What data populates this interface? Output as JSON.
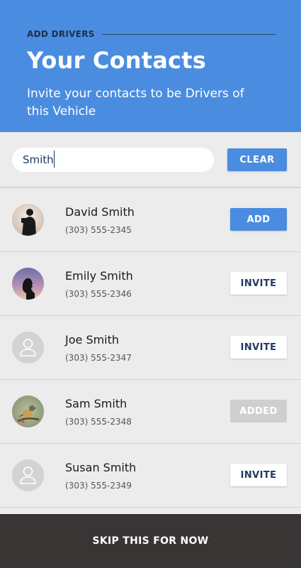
{
  "header": {
    "eyebrow": "ADD DRIVERS",
    "title": "Your Contacts",
    "subtitle": "Invite your contacts to be Drivers of this Vehicle"
  },
  "search": {
    "value": "Smith",
    "clear_label": "CLEAR"
  },
  "contacts": [
    {
      "name": "David Smith",
      "phone": "(303) 555-2345",
      "action": "ADD",
      "avatar": "photographer-silhouette-photo"
    },
    {
      "name": "Emily Smith",
      "phone": "(303) 555-2346",
      "action": "INVITE",
      "avatar": "sunset-silhouette-photo"
    },
    {
      "name": "Joe Smith",
      "phone": "(303) 555-2347",
      "action": "INVITE",
      "avatar": "default-person-icon"
    },
    {
      "name": "Sam Smith",
      "phone": "(303) 555-2348",
      "action": "ADDED",
      "avatar": "bird-photo"
    },
    {
      "name": "Susan Smith",
      "phone": "(303) 555-2349",
      "action": "INVITE",
      "avatar": "default-person-icon"
    }
  ],
  "footer": {
    "skip_label": "SKIP THIS FOR NOW"
  },
  "colors": {
    "header_blue": "#4a8de0",
    "dark_navy": "#1c3a5e",
    "footer_dark": "#3a3535",
    "added_gray": "#cfcfcf"
  }
}
